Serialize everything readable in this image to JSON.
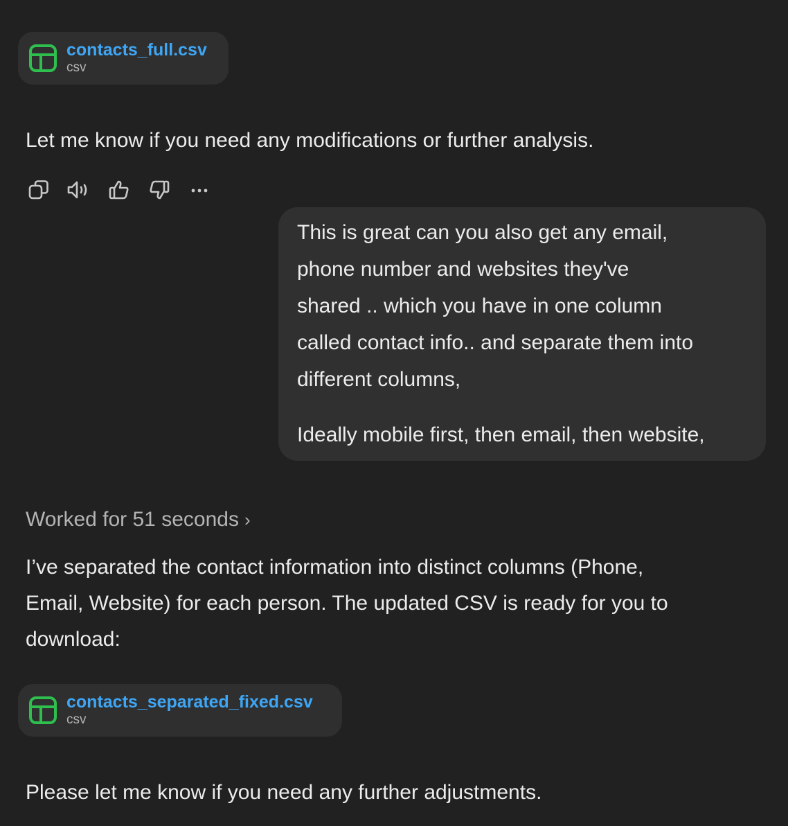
{
  "attachment_top": {
    "name": "contacts_full.csv",
    "type": "csv"
  },
  "assistant_msg_1": "Let me know if you need any modifications or further analysis.",
  "actions": {
    "copy_icon": "copy-icon",
    "read_aloud_icon": "speaker-icon",
    "good_icon": "thumbs-up-icon",
    "bad_icon": "thumbs-down-icon",
    "more_icon": "more-icon"
  },
  "user_msg": {
    "lines": [
      "This is great can you also get any email,",
      "phone number and websites they've",
      "shared .. which you have in one column",
      "called contact info.. and separate them into",
      "different columns,"
    ],
    "line2": "Ideally mobile first, then email, then website,"
  },
  "worked": {
    "label": "Worked for 51 seconds",
    "chevron": "›"
  },
  "assistant_msg_2": {
    "lines": [
      "I’ve separated the contact information into distinct columns (Phone,",
      "Email, Website) for each person. The updated CSV is ready for you to",
      "download:"
    ]
  },
  "attachment_bottom": {
    "name": "contacts_separated_fixed.csv",
    "type": "csv"
  },
  "assistant_msg_3": "Please let me know if you need any further adjustments.",
  "colors": {
    "background": "#212121",
    "bubble": "#303030",
    "link": "#3ea6f5",
    "spreadsheet_green": "#2fbf4f"
  }
}
